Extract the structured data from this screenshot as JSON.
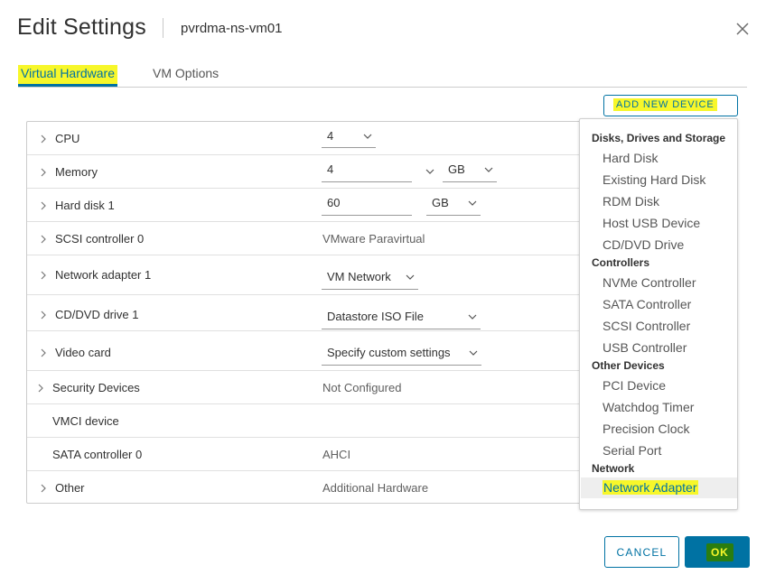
{
  "header": {
    "title": "Edit Settings",
    "vm_name": "pvrdma-ns-vm01"
  },
  "tabs": [
    {
      "label": "Virtual Hardware",
      "active": true
    },
    {
      "label": "VM Options",
      "active": false
    }
  ],
  "add_device_button": "ADD NEW DEVICE",
  "hardware": {
    "cpu": {
      "label": "CPU",
      "value": "4"
    },
    "memory": {
      "label": "Memory",
      "value": "4",
      "unit": "GB"
    },
    "hard_disk": {
      "label": "Hard disk 1",
      "value": "60",
      "unit": "GB"
    },
    "scsi": {
      "label": "SCSI controller 0",
      "value": "VMware Paravirtual"
    },
    "network": {
      "label": "Network adapter 1",
      "value": "VM Network"
    },
    "cdrom": {
      "label": "CD/DVD drive 1",
      "value": "Datastore ISO File"
    },
    "video": {
      "label": "Video card",
      "value": "Specify custom settings"
    },
    "security": {
      "label": "Security Devices",
      "value": "Not Configured"
    },
    "vmci": {
      "label": "VMCI device",
      "value": ""
    },
    "sata": {
      "label": "SATA controller 0",
      "value": "AHCI"
    },
    "other": {
      "label": "Other",
      "value": "Additional Hardware"
    }
  },
  "menu": {
    "group1": "Disks, Drives and Storage",
    "group1_items": [
      "Hard Disk",
      "Existing Hard Disk",
      "RDM Disk",
      "Host USB Device",
      "CD/DVD Drive"
    ],
    "group2": "Controllers",
    "group2_items": [
      "NVMe Controller",
      "SATA Controller",
      "SCSI Controller",
      "USB Controller"
    ],
    "group3": "Other Devices",
    "group3_items": [
      "PCI Device",
      "Watchdog Timer",
      "Precision Clock",
      "Serial Port"
    ],
    "group4": "Network",
    "group4_items": [
      "Network Adapter"
    ]
  },
  "footer": {
    "cancel_label": "CANCEL",
    "ok_label": "OK"
  },
  "colors": {
    "accent": "#0072a3",
    "highlight": "#f7f72a",
    "ok_highlight": "#2a7d10"
  },
  "icons": [
    "close-icon",
    "chevron-right-icon",
    "chevron-down-icon"
  ]
}
